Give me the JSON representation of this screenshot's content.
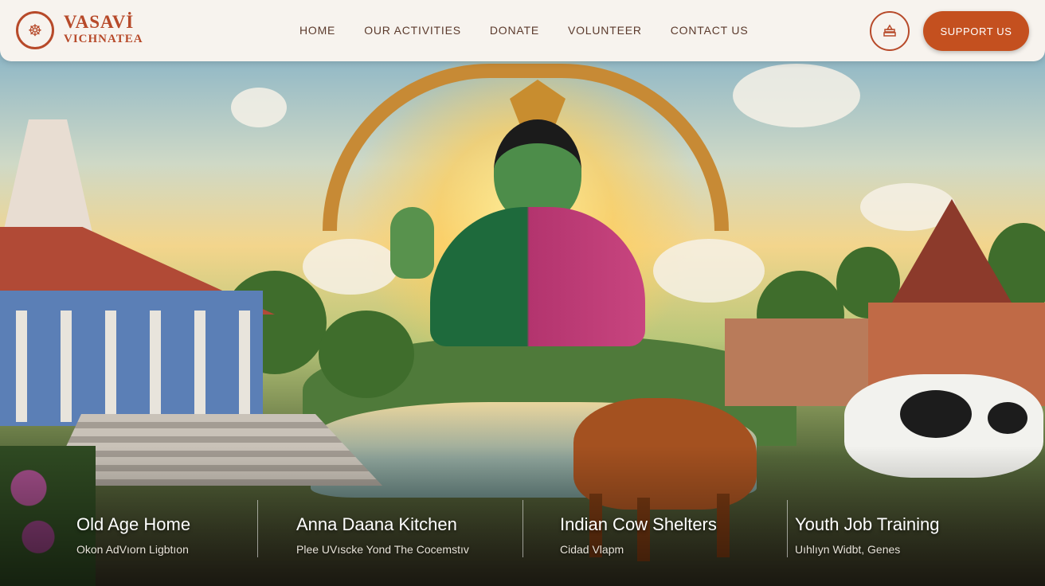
{
  "brand": {
    "name_line1": "VASAVİ",
    "name_line2": "VICHNATEA"
  },
  "nav": {
    "items": [
      {
        "label": "HOME"
      },
      {
        "label": "OUR ACTIVITIES"
      },
      {
        "label": "DONATE"
      },
      {
        "label": "VOLUNTEER"
      },
      {
        "label": "CONTACT US"
      }
    ],
    "support_label": "SUPPORT US",
    "icon": "temple-icon"
  },
  "cards": [
    {
      "title": "Old Age Home",
      "subtitle": "Okon AdVıorn Ligbtıon"
    },
    {
      "title": "Anna Daana Kitchen",
      "subtitle": "Plee UVıscke Yond The Cocemstıv"
    },
    {
      "title": "Indian Cow Shelters",
      "subtitle": "Cidad Vlapm"
    },
    {
      "title": "Youth Job Training",
      "subtitle": "Uıhlıyn Widbt, Genes"
    }
  ],
  "colors": {
    "accent": "#c4501f",
    "nav_bg": "#f7f3ee",
    "nav_text": "#5b3a2c"
  }
}
